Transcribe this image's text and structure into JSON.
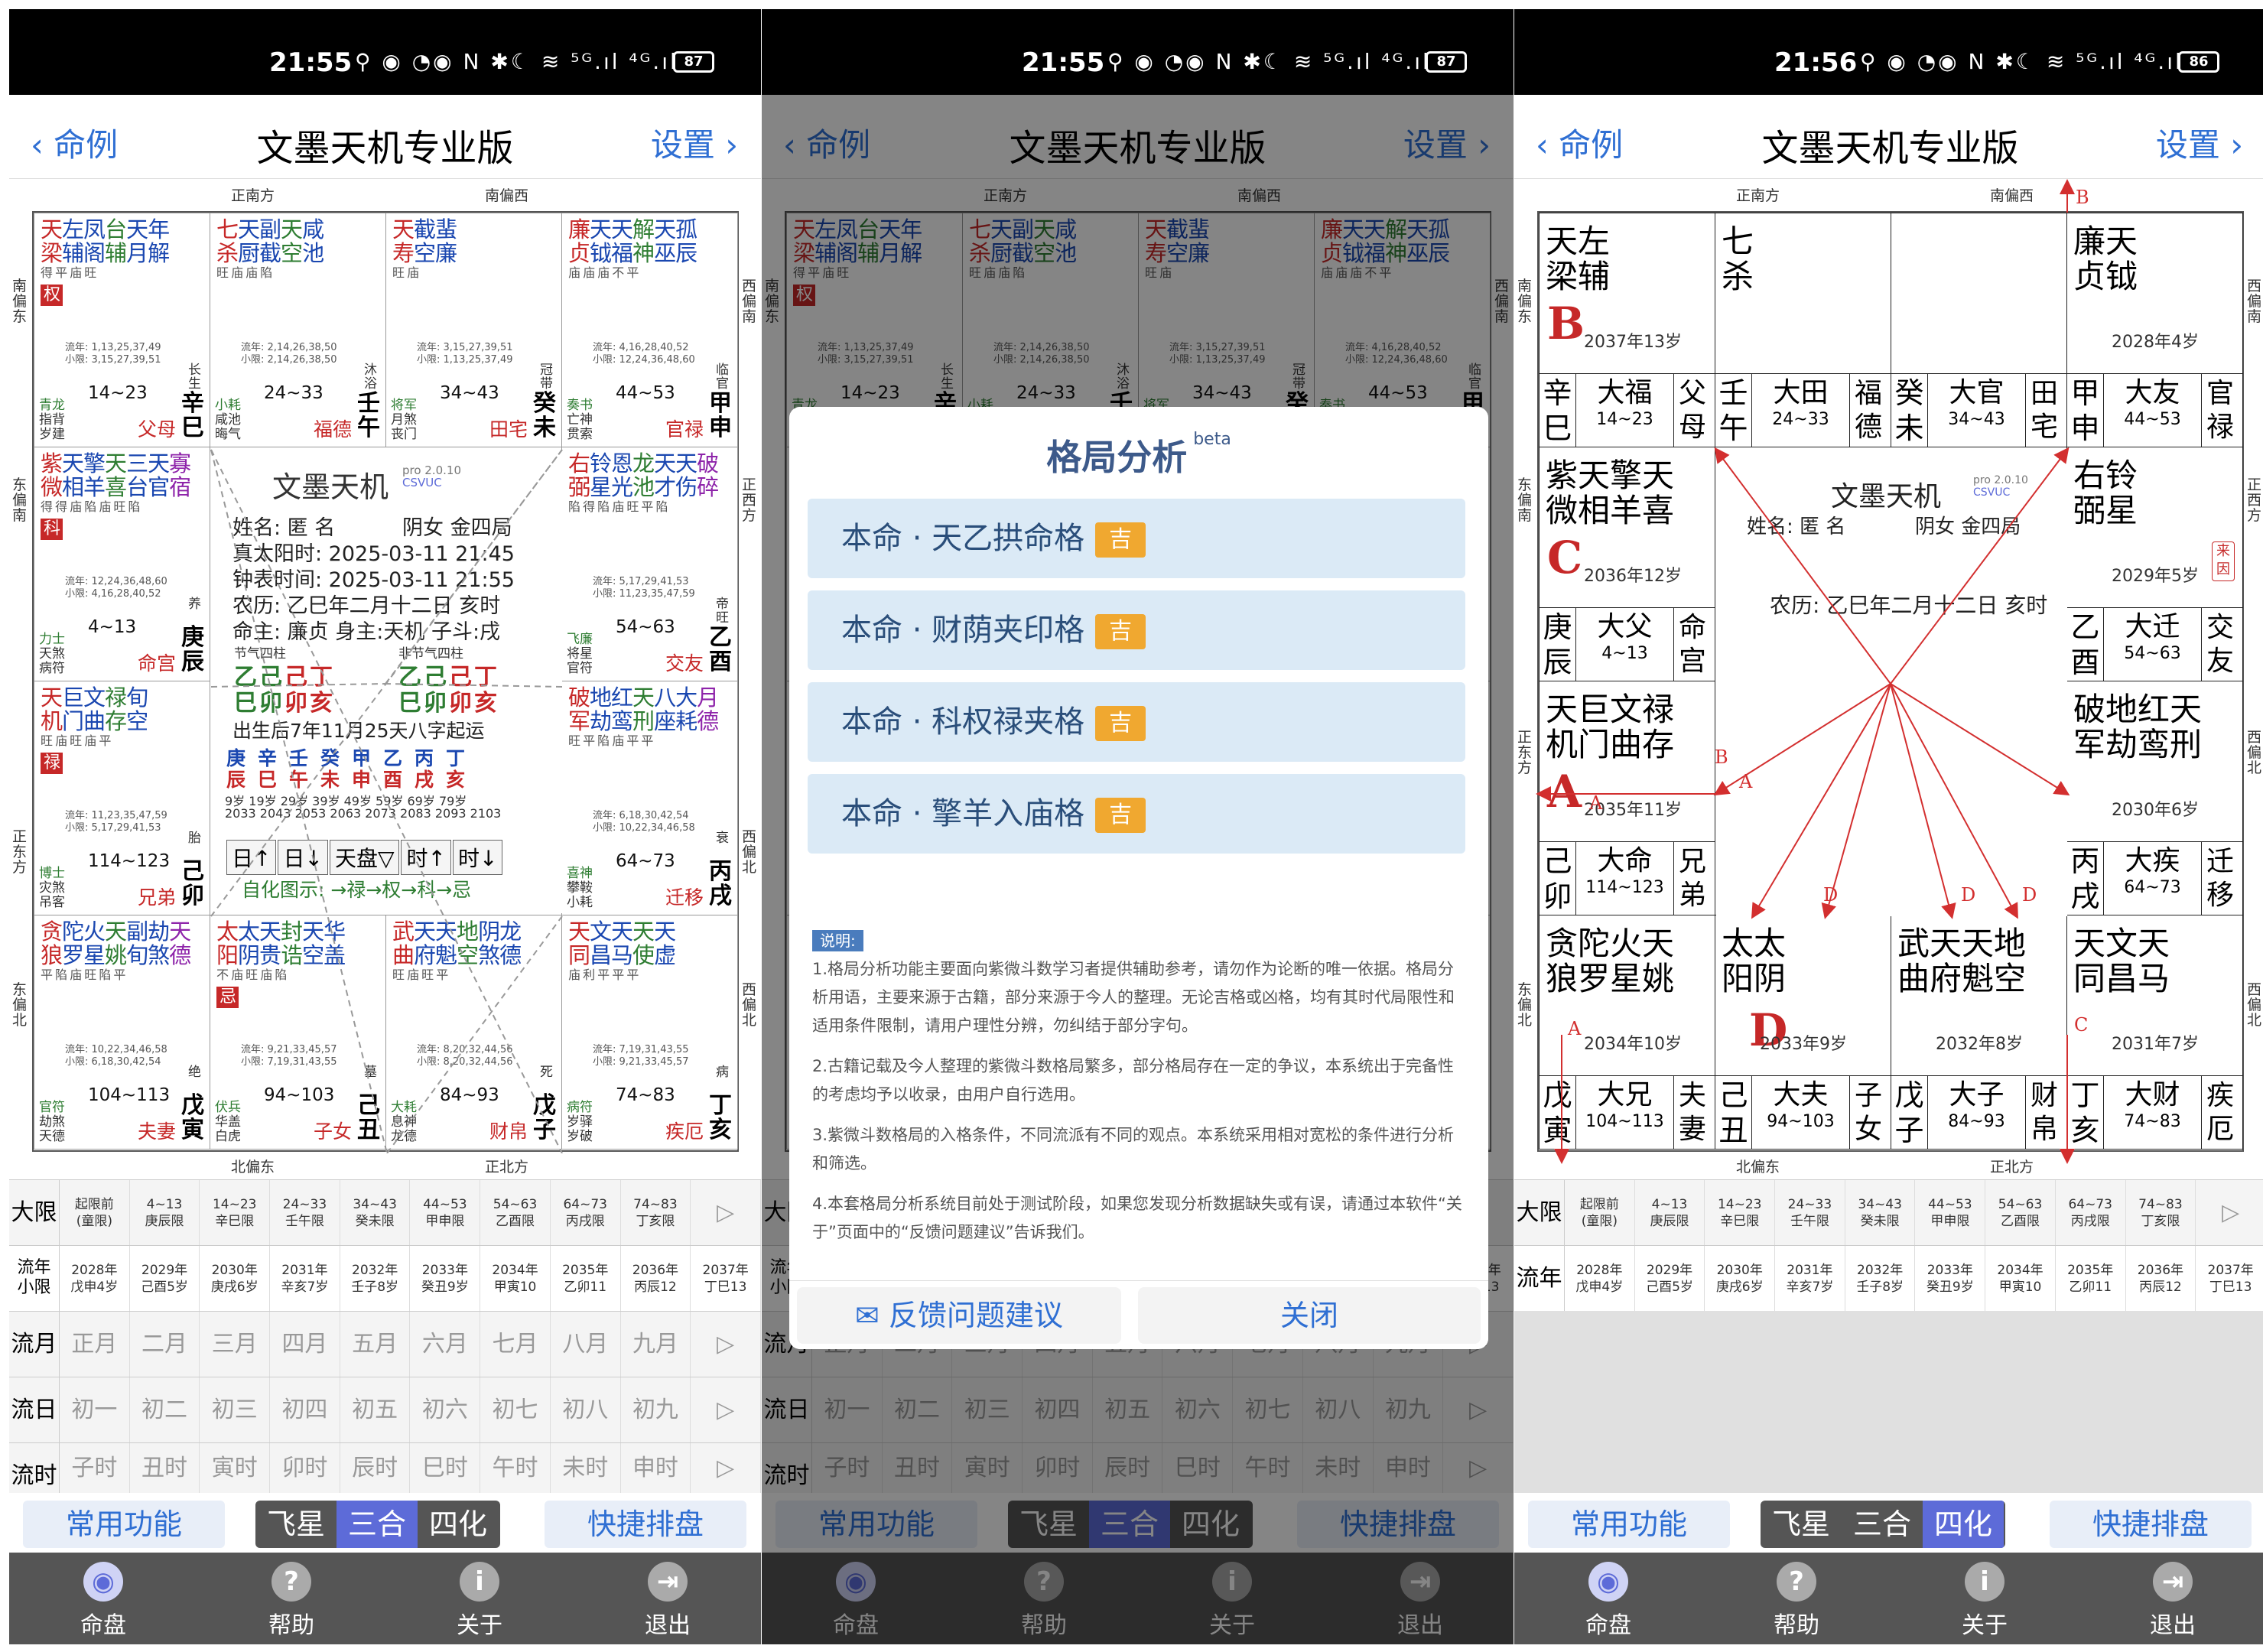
{
  "status": {
    "time1": "21:55",
    "time3": "21:56",
    "icons": "⚲ ◉ ◔◉ N ✱☾ ≋ ⁵ᴳ.ıl ⁴ᴳ.ıl",
    "batt1": "87",
    "batt3": "86"
  },
  "nav": {
    "back": "命例",
    "title": "文墨天机专业版",
    "settings": "设置"
  },
  "dirs": {
    "top_l": "正南方",
    "top_r": "南偏西",
    "bot_l": "北偏东",
    "bot_r": "正北方",
    "lt": "南偏东",
    "lm": "东偏南",
    "lb": "东偏北",
    "rt": "西偏南",
    "rm": "正西方",
    "rb": "西偏北",
    "lc": "正东方",
    "rc": "西偏北"
  },
  "chart_cells": [
    {
      "s1": "天左凤台天年",
      "s2": "梁辅阁辅月解",
      "st": "得 平 庙       旺",
      "hua": "权",
      "l1": "流年: 1,13,25,37,49",
      "l2": "小限: 3,15,27,39,51",
      "age": "14~23",
      "gz": "辛巳",
      "pal": "父母",
      "ch": "长生",
      "sd1": "青龙",
      "sd2": "指背",
      "sd3": "岁建"
    },
    {
      "s1": "七天副天咸",
      "s2": "杀厨截空池",
      "st": "旺     庙 庙 陷",
      "hua": "",
      "l1": "流年: 2,14,26,38,50",
      "l2": "小限: 2,14,26,38,50",
      "age": "24~33",
      "gz": "壬午",
      "pal": "福德",
      "ch": "沐浴",
      "sd1": "小耗",
      "sd2": "咸池",
      "sd3": "晦气"
    },
    {
      "s1": "天截蜚",
      "s2": "寿空廉",
      "st": "旺 庙",
      "hua": "",
      "l1": "流年: 3,15,27,39,51",
      "l2": "小限: 1,13,25,37,49",
      "age": "34~43",
      "gz": "癸未",
      "pal": "田宅",
      "ch": "冠带",
      "sd1": "将军",
      "sd2": "月煞",
      "sd3": "丧门"
    },
    {
      "s1": "廉天天解天孤",
      "s2": "贞钺福神巫辰",
      "st": "庙 庙 庙 不     平",
      "hua": "",
      "l1": "流年: 4,16,28,40,52",
      "l2": "小限: 12,24,36,48,60",
      "age": "44~53",
      "gz": "甲申",
      "pal": "官禄",
      "ch": "临官",
      "sd1": "奏书",
      "sd2": "亡神",
      "sd3": "贯索"
    },
    {
      "s1": "紫天擎天三天寡",
      "s2": "微相羊喜台官宿",
      "st": "得 得 庙 陷 庙 旺 陷",
      "hua": "科",
      "l1": "流年: 12,24,36,48,60",
      "l2": "小限: 4,16,28,40,52",
      "age": "4~13",
      "gz": "庚辰",
      "pal": "命宫",
      "ch": "养",
      "sd1": "力士",
      "sd2": "天煞",
      "sd3": "病符"
    },
    {
      "s1": "右铃恩龙天天破",
      "s2": "弼星光池才伤碎",
      "st": "陷 得 陷 庙 旺 平 陷",
      "hua": "",
      "l1": "流年: 5,17,29,41,53",
      "l2": "小限: 11,23,35,47,59",
      "age": "54~63",
      "gz": "乙酉",
      "pal": "交友",
      "ch": "帝旺",
      "sd1": "飞廉",
      "sd2": "将星",
      "sd3": "官符"
    },
    {
      "s1": "天巨文禄旬",
      "s2": "机门曲存空",
      "st": "旺 庙 旺 庙 平",
      "hua": "禄",
      "l1": "流年: 11,23,35,47,59",
      "l2": "小限: 5,17,29,41,53",
      "age": "114~123",
      "gz": "己卯",
      "pal": "兄弟",
      "ch": "胎",
      "sd1": "博士",
      "sd2": "灾煞",
      "sd3": "吊客"
    },
    {
      "s1": "破地红天八大月",
      "s2": "军劫鸾刑座耗德",
      "st": "旺 平 陷 庙 平 平",
      "hua": "",
      "l1": "流年: 6,18,30,42,54",
      "l2": "小限: 10,22,34,46,58",
      "age": "64~73",
      "gz": "丙戌",
      "pal": "迁移",
      "ch": "衰",
      "sd1": "喜神",
      "sd2": "攀鞍",
      "sd3": "小耗"
    },
    {
      "s1": "贪陀火天副劫天",
      "s2": "狼罗星姚旬煞德",
      "st": "平 陷 庙 旺 陷       平",
      "hua": "",
      "l1": "流年: 10,22,34,46,58",
      "l2": "小限: 6,18,30,42,54",
      "age": "104~113",
      "gz": "戊寅",
      "pal": "夫妻",
      "ch": "绝",
      "sd1": "官符",
      "sd2": "劫煞",
      "sd3": "天德"
    },
    {
      "s1": "太太天封天华",
      "s2": "阳阴贵诰空盖",
      "st": "不 庙 旺       庙 陷",
      "hua": "忌",
      "l1": "流年: 9,21,33,45,57",
      "l2": "小限: 7,19,31,43,55",
      "age": "94~103",
      "gz": "己丑",
      "pal": "子女",
      "ch": "墓",
      "sd1": "伏兵",
      "sd2": "华盖",
      "sd3": "白虎"
    },
    {
      "s1": "武天天地阴龙",
      "s2": "曲府魁空煞德",
      "st": "旺 庙 旺 平",
      "hua": "",
      "l1": "流年: 8,20,32,44,56",
      "l2": "小限: 8,20,32,44,56",
      "age": "84~93",
      "gz": "戊子",
      "pal": "财帛",
      "ch": "死",
      "sd1": "大耗",
      "sd2": "息神",
      "sd3": "龙德"
    },
    {
      "s1": "天文天天天",
      "s2": "同昌马使虚",
      "st": "庙 利 平 平 平",
      "hua": "",
      "l1": "流年: 7,19,31,43,55",
      "l2": "小限: 9,21,33,45,57",
      "age": "74~83",
      "gz": "丁亥",
      "pal": "疾厄",
      "ch": "病",
      "sd1": "病符",
      "sd2": "岁驿",
      "sd3": "岁破"
    }
  ],
  "center": {
    "title": "文墨天机",
    "ver": "pro 2.0.10",
    "csv": "CSVUC",
    "name": "姓名: 匿 名",
    "sex": "阴女 金四局",
    "solar": "真太阳时: 2025-03-11 21:45",
    "clock": "钟表时间: 2025-03-11 21:55",
    "lunar": "农历: 乙巳年二月十二日 亥时",
    "lord": "命主: 廉贞 身主:天机 子斗:戌",
    "jq1": "节气四柱",
    "jq2": "非节气四柱",
    "gz_top": "乙己己丁",
    "gz_bot": "巳卯卯亥",
    "gz_top2": "乙己己丁",
    "gz_bot2": "巳卯卯亥",
    "qiyun": "出生后7年11月25天八字起运",
    "dayun_top": "庚辛壬癸甲乙丙丁",
    "dayun_bot": "辰巳午未申酉戌亥",
    "dayun_age": "9岁  19岁  29岁  39岁  49岁  59岁  69岁  79岁",
    "dayun_yr": "2033  2043  2053  2063  2073  2083  2093  2103",
    "btn1": "日↑",
    "btn2": "日↓",
    "btn3": "天盘▽",
    "btn4": "时↑",
    "btn5": "时↓",
    "zihua": "自化图示: →禄→权→科→忌"
  },
  "dayun_row": {
    "label": "大限",
    "items": [
      "起限前\n(童限)",
      "4~13\n庚辰限",
      "14~23\n辛巳限",
      "24~33\n壬午限",
      "34~43\n癸未限",
      "44~53\n甲申限",
      "54~63\n乙酉限",
      "64~73\n丙戌限",
      "74~83\n丁亥限"
    ],
    "more": "▷"
  },
  "liunian_row": {
    "label": "流年\n小限",
    "label3": "流年",
    "items": [
      "2028年\n戊申4岁",
      "2029年\n己酉5岁",
      "2030年\n庚戌6岁",
      "2031年\n辛亥7岁",
      "2032年\n壬子8岁",
      "2033年\n癸丑9岁",
      "2034年\n甲寅10",
      "2035年\n乙卯11",
      "2036年\n丙辰12",
      "2037年\n丁巳13"
    ]
  },
  "liuyue_row": {
    "label": "流月",
    "items": [
      "正月",
      "二月",
      "三月",
      "四月",
      "五月",
      "六月",
      "七月",
      "八月",
      "九月"
    ],
    "more": "▷"
  },
  "liuri_row": {
    "label": "流日",
    "items": [
      "初一",
      "初二",
      "初三",
      "初四",
      "初五",
      "初六",
      "初七",
      "初八",
      "初九"
    ],
    "more": "▷"
  },
  "liushi_row": {
    "label": "流时",
    "items": [
      "子时",
      "丑时",
      "寅时",
      "卯时",
      "辰时",
      "巳时",
      "午时",
      "未时",
      "申时"
    ],
    "more": "▷"
  },
  "toolbar": {
    "common": "常用功能",
    "seg1": "飞星",
    "seg2": "三合",
    "seg3": "四化",
    "quick": "快捷排盘"
  },
  "tabs": [
    {
      "label": "命盘",
      "icon": "◉"
    },
    {
      "label": "帮助",
      "icon": "?"
    },
    {
      "label": "关于",
      "icon": "i"
    },
    {
      "label": "退出",
      "icon": "⇥"
    }
  ],
  "modal": {
    "title": "格局分析",
    "beta": "beta",
    "pat1": "本命 · 天乙拱命格",
    "pat2": "本命 · 财荫夹印格",
    "pat3": "本命 · 科权禄夹格",
    "pat4": "本命 · 擎羊入庙格",
    "tag": "吉",
    "note_h": "说明:",
    "n1": "1.格局分析功能主要面向紫微斗数学习者提供辅助参考，请勿作为论断的唯一依据。格局分析用语，主要来源于古籍，部分来源于今人的整理。无论吉格或凶格，均有其时代局限性和适用条件限制，请用户理性分辨，勿纠结于部分字句。",
    "n2": "2.古籍记载及今人整理的紫微斗数格局繁多，部分格局存在一定的争议，本系统出于完备性的考虑均予以收录，由用户自行选用。",
    "n3": "3.紫微斗数格局的入格条件，不同流派有不同的观点。本系统采用相对宽松的条件进行分析和筛选。",
    "n4": "4.本套格局分析系统目前处于测试阶段，如果您发现分析数据缺失或有误，请通过本软件“关于”页面中的“反馈问题建议”告诉我们。",
    "feedback": "✉ 反馈问题建议",
    "close": "关闭"
  },
  "board3": {
    "cells": [
      {
        "s": "天左\n梁辅",
        "let": "B",
        "yr": "2037年13岁",
        "g1": "辛\n巳",
        "g2": "大福",
        "g2s": "14~23",
        "g3": "父\n母"
      },
      {
        "s": "七\n杀",
        "let": "",
        "yr": "",
        "g1": "壬\n午",
        "g2": "大田",
        "g2s": "24~33",
        "g3": "福\n德"
      },
      {
        "s": "",
        "let": "",
        "yr": "",
        "g1": "癸\n未",
        "g2": "大官",
        "g2s": "34~43",
        "g3": "田\n宅"
      },
      {
        "s": "廉天\n贞钺",
        "let": "",
        "yr": "2028年4岁",
        "g1": "甲\n申",
        "g2": "大友",
        "g2s": "44~53",
        "g3": "官\n禄"
      },
      {
        "s": "紫天擎天\n微相羊喜",
        "let": "C",
        "yr": "2036年12岁",
        "g1": "庚\n辰",
        "g2": "大父",
        "g2s": "4~13",
        "g3": "命\n宫"
      },
      {
        "s": "右铃\n弼星",
        "let": "",
        "yr": "2029年5岁",
        "g1": "乙\n酉",
        "g2": "大迁",
        "g2s": "54~63",
        "g3": "交\n友"
      },
      {
        "s": "天巨文禄\n机门曲存",
        "let": "A",
        "yr": "2035年11岁",
        "g1": "己\n卯",
        "g2": "大命",
        "g2s": "114~123",
        "g3": "兄\n弟"
      },
      {
        "s": "破地红天\n军劫鸾刑",
        "let": "",
        "yr": "2030年6岁",
        "g1": "丙\n戌",
        "g2": "大疾",
        "g2s": "64~73",
        "g3": "迁\n移"
      },
      {
        "s": "贪陀火天\n狼罗星姚",
        "let": "",
        "yr": "2034年10岁",
        "g1": "戊\n寅",
        "g2": "大兄",
        "g2s": "104~113",
        "g3": "夫\n妻"
      },
      {
        "s": "太太\n阳阴",
        "let": "D",
        "yr": "2033年9岁",
        "g1": "己\n丑",
        "g2": "大夫",
        "g2s": "94~103",
        "g3": "子\n女"
      },
      {
        "s": "武天天地\n曲府魁空",
        "let": "",
        "yr": "2032年8岁",
        "g1": "戊\n子",
        "g2": "大子",
        "g2s": "84~93",
        "g3": "财\n帛"
      },
      {
        "s": "天文天\n同昌马",
        "let": "",
        "yr": "2031年7岁",
        "g1": "丁\n亥",
        "g2": "大财",
        "g2s": "74~83",
        "g3": "疾\n厄"
      }
    ],
    "ctr_title": "文墨天机",
    "ctr_name": "姓名: 匿 名",
    "ctr_sex": "阴女 金四局",
    "ctr_lunar": "农历: 乙巳年二月十二日 亥时",
    "lai": "来因",
    "arrows": [
      "A",
      "B",
      "C",
      "D",
      "D",
      "D",
      "A",
      "A",
      "B"
    ]
  }
}
